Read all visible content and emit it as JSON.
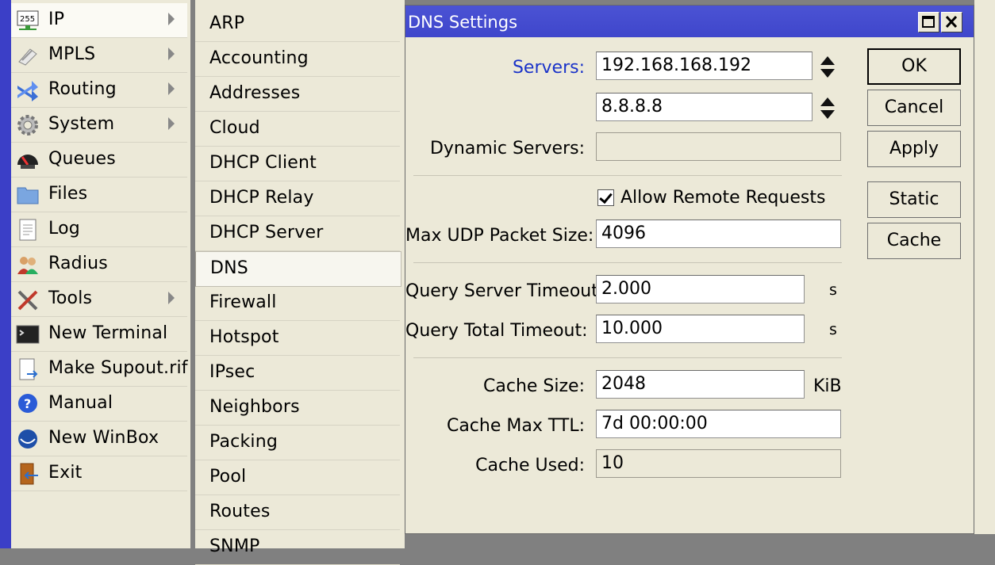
{
  "main_menu": [
    {
      "label": "IP",
      "icon": "ip-address-icon",
      "has_submenu": true,
      "active": true
    },
    {
      "label": "MPLS",
      "icon": "mpls-icon",
      "has_submenu": true
    },
    {
      "label": "Routing",
      "icon": "routing-icon",
      "has_submenu": true
    },
    {
      "label": "System",
      "icon": "gear-icon",
      "has_submenu": true
    },
    {
      "label": "Queues",
      "icon": "queues-gauge-icon"
    },
    {
      "label": "Files",
      "icon": "folder-icon"
    },
    {
      "label": "Log",
      "icon": "log-document-icon"
    },
    {
      "label": "Radius",
      "icon": "users-icon"
    },
    {
      "label": "Tools",
      "icon": "tools-icon",
      "has_submenu": true
    },
    {
      "label": "New Terminal",
      "icon": "terminal-icon"
    },
    {
      "label": "Make Supout.rif",
      "icon": "file-export-icon"
    },
    {
      "label": "Manual",
      "icon": "help-icon"
    },
    {
      "label": "New WinBox",
      "icon": "winbox-icon"
    },
    {
      "label": "Exit",
      "icon": "exit-door-icon"
    }
  ],
  "ip_submenu": [
    "ARP",
    "Accounting",
    "Addresses",
    "Cloud",
    "DHCP Client",
    "DHCP Relay",
    "DHCP Server",
    "DNS",
    "Firewall",
    "Hotspot",
    "IPsec",
    "Neighbors",
    "Packing",
    "Pool",
    "Routes",
    "SNMP"
  ],
  "ip_submenu_selected": "DNS",
  "dialog": {
    "title": "DNS Settings",
    "servers_label": "Servers:",
    "server_1": "192.168.168.192",
    "server_2": "8.8.8.8",
    "dynamic_servers_label": "Dynamic Servers:",
    "dynamic_servers_value": "",
    "allow_remote_label": "Allow Remote Requests",
    "allow_remote_checked": true,
    "max_udp_label": "Max UDP Packet Size:",
    "max_udp_value": "4096",
    "query_server_timeout_label": "Query Server Timeout:",
    "query_server_timeout_value": "2.000",
    "query_server_timeout_unit": "s",
    "query_total_timeout_label": "Query Total Timeout:",
    "query_total_timeout_value": "10.000",
    "query_total_timeout_unit": "s",
    "cache_size_label": "Cache Size:",
    "cache_size_value": "2048",
    "cache_size_unit": "KiB",
    "cache_max_ttl_label": "Cache Max TTL:",
    "cache_max_ttl_value": "7d 00:00:00",
    "cache_used_label": "Cache Used:",
    "cache_used_value": "10",
    "buttons": {
      "ok": "OK",
      "cancel": "Cancel",
      "apply": "Apply",
      "static": "Static",
      "cache": "Cache"
    }
  },
  "colors": {
    "title_bar": "#4049cf",
    "field_label_active": "#1a33c9",
    "panel_bg": "#ece9d8"
  }
}
